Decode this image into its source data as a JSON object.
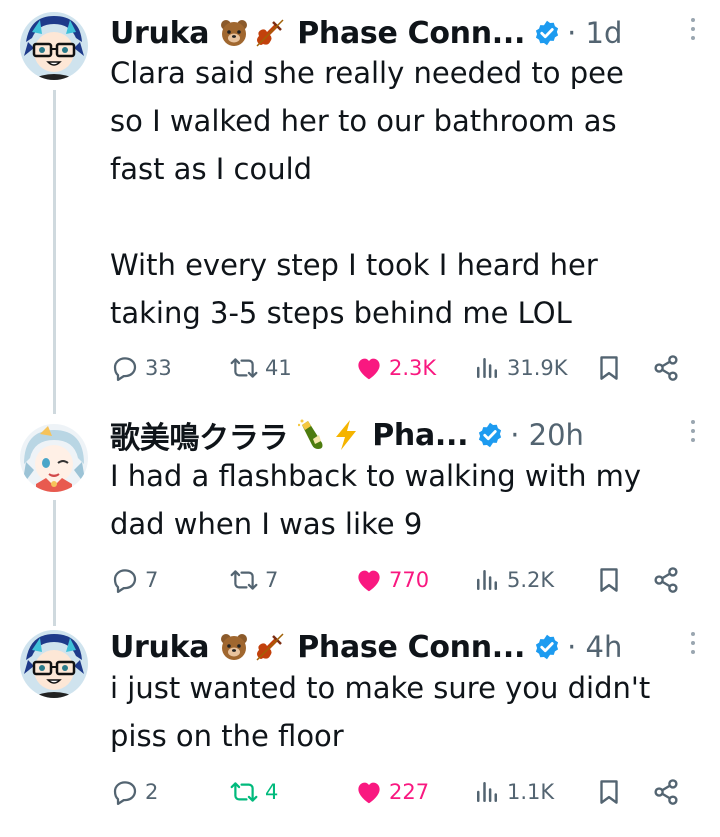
{
  "tweets": [
    {
      "author": "Uruka",
      "emojis": [
        "🐻",
        "🎻"
      ],
      "suffix": "Phase Conn...",
      "dot": "·",
      "time": "1d",
      "text": "Clara said she really needed to pee\nso I walked her to our bathroom as\nfast as I could\n\nWith every step I took I heard her\ntaking 3-5 steps behind me LOL",
      "replies": "33",
      "reposts": "41",
      "likes": "2.3K",
      "views": "31.9K",
      "liked": true,
      "reposted": false
    },
    {
      "author": "歌美鳴クララ",
      "emojis": [
        "🍾",
        "⚡"
      ],
      "suffix": "Pha...",
      "dot": "·",
      "time": "20h",
      "text": "I had a flashback to walking with my\ndad when I was like 9",
      "replies": "7",
      "reposts": "7",
      "likes": "770",
      "views": "5.2K",
      "liked": true,
      "reposted": false
    },
    {
      "author": "Uruka",
      "emojis": [
        "🐻",
        "🎻"
      ],
      "suffix": "Phase Conn...",
      "dot": "·",
      "time": "4h",
      "text": "i just wanted to make sure you didn't\npiss on the floor",
      "replies": "2",
      "reposts": "4",
      "likes": "227",
      "views": "1.1K",
      "liked": true,
      "reposted": true
    }
  ],
  "colors": {
    "verified": "#1d9bf0",
    "like": "#f91880",
    "repost": "#00ba7c",
    "muted": "#536471",
    "thread_line": "#cfd9de"
  },
  "icons": [
    "reply-icon",
    "repost-icon",
    "like-icon",
    "views-icon",
    "bookmark-icon",
    "share-icon",
    "verified-badge-icon",
    "more-icon"
  ]
}
